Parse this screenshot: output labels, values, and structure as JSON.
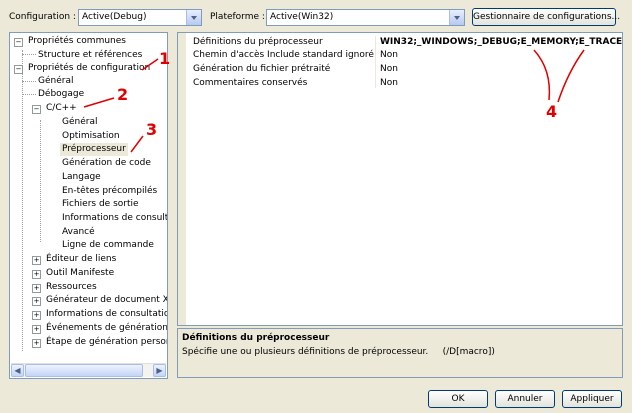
{
  "toolbar": {
    "configuration_label": "Configuration :",
    "configuration_value": "Active(Debug)",
    "platform_label": "Plateforme :",
    "platform_value": "Active(Win32)",
    "manager_button": "Gestionnaire de configurations..."
  },
  "tree": {
    "common_props": "Propriétés communes",
    "structure_refs": "Structure et références",
    "config_props": "Propriétés de configuration",
    "general": "Général",
    "debugging": "Débogage",
    "cpp": "C/C++",
    "cpp_children": [
      "Général",
      "Optimisation",
      "Préprocesseur",
      "Génération de code",
      "Langage",
      "En-têtes précompilés",
      "Fichiers de sortie",
      "Informations de consultation",
      "Avancé",
      "Ligne de commande"
    ],
    "more": [
      "Éditeur de liens",
      "Outil Manifeste",
      "Ressources",
      "Générateur de document XML",
      "Informations de consultation",
      "Événements de génération",
      "Étape de génération personnalisée"
    ]
  },
  "grid": {
    "rows": [
      {
        "name": "Définitions du préprocesseur",
        "value": "WIN32;_WINDOWS;_DEBUG;E_MEMORY;E_TRACE"
      },
      {
        "name": "Chemin d'accès Include standard ignoré",
        "value": "Non"
      },
      {
        "name": "Génération du fichier prétraité",
        "value": "Non"
      },
      {
        "name": "Commentaires conservés",
        "value": "Non"
      }
    ]
  },
  "description": {
    "title": "Définitions du préprocesseur",
    "text": "Spécifie une ou plusieurs définitions de préprocesseur.     (/D[macro])"
  },
  "buttons": {
    "ok": "OK",
    "cancel": "Annuler",
    "apply": "Appliquer"
  },
  "annotations": [
    "1",
    "2",
    "3",
    "4"
  ],
  "colors": {
    "annotation": "#e00000",
    "dialog_bg": "#ece9d8",
    "border": "#7f9db9"
  }
}
